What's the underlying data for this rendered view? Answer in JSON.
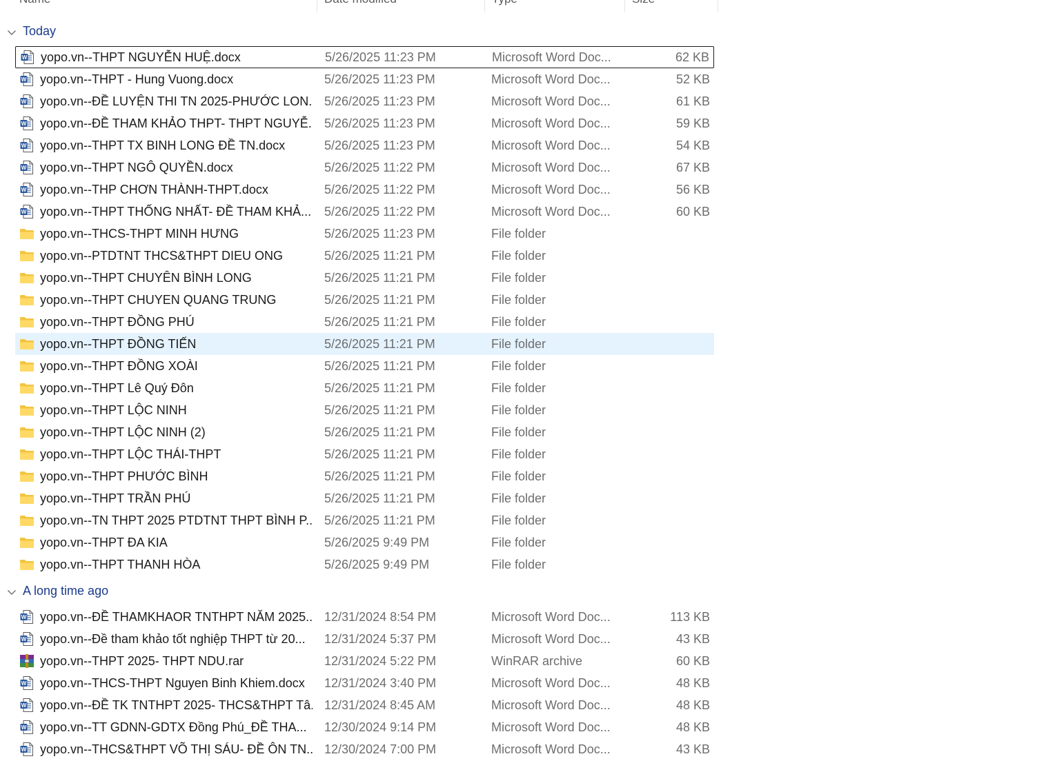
{
  "columns": {
    "name": "Name",
    "date": "Date modified",
    "type": "Type",
    "size": "Size"
  },
  "groups": [
    {
      "label": "Today",
      "rows": [
        {
          "icon": "word-doc-icon",
          "name": "yopo.vn--THPT NGUYỄN HUỆ.docx",
          "date": "5/26/2025 11:23 PM",
          "type": "Microsoft Word Doc...",
          "size": "62 KB"
        },
        {
          "icon": "word-doc-icon",
          "name": "yopo.vn--THPT - Hung Vuong.docx",
          "date": "5/26/2025 11:23 PM",
          "type": "Microsoft Word Doc...",
          "size": "52 KB"
        },
        {
          "icon": "word-doc-icon",
          "name": "yopo.vn--ĐỀ LUYỆN THI TN 2025-PHƯỚC LON...",
          "date": "5/26/2025 11:23 PM",
          "type": "Microsoft Word Doc...",
          "size": "61 KB"
        },
        {
          "icon": "word-doc-icon",
          "name": "yopo.vn--ĐỀ THAM KHẢO THPT- THPT NGUYỄ...",
          "date": "5/26/2025 11:23 PM",
          "type": "Microsoft Word Doc...",
          "size": "59 KB"
        },
        {
          "icon": "word-doc-icon",
          "name": "yopo.vn--THPT TX BINH LONG ĐỀ TN.docx",
          "date": "5/26/2025 11:23 PM",
          "type": "Microsoft Word Doc...",
          "size": "54 KB"
        },
        {
          "icon": "word-doc-icon",
          "name": "yopo.vn--THPT NGÔ QUYỀN.docx",
          "date": "5/26/2025 11:22 PM",
          "type": "Microsoft Word Doc...",
          "size": "67 KB"
        },
        {
          "icon": "word-doc-icon",
          "name": "yopo.vn--THP CHƠN THÀNH-THPT.docx",
          "date": "5/26/2025 11:22 PM",
          "type": "Microsoft Word Doc...",
          "size": "56 KB"
        },
        {
          "icon": "word-doc-icon",
          "name": "yopo.vn--THPT THỐNG NHẤT- ĐỀ THAM KHẢ...",
          "date": "5/26/2025 11:22 PM",
          "type": "Microsoft Word Doc...",
          "size": "60 KB"
        },
        {
          "icon": "folder-icon",
          "name": "yopo.vn--THCS-THPT MINH HƯNG",
          "date": "5/26/2025 11:23 PM",
          "type": "File folder",
          "size": ""
        },
        {
          "icon": "folder-icon",
          "name": "yopo.vn--PTDTNT THCS&THPT DIEU ONG",
          "date": "5/26/2025 11:21 PM",
          "type": "File folder",
          "size": ""
        },
        {
          "icon": "folder-icon",
          "name": "yopo.vn--THPT CHUYÊN BÌNH LONG",
          "date": "5/26/2025 11:21 PM",
          "type": "File folder",
          "size": ""
        },
        {
          "icon": "folder-icon",
          "name": "yopo.vn--THPT CHUYEN QUANG TRUNG",
          "date": "5/26/2025 11:21 PM",
          "type": "File folder",
          "size": ""
        },
        {
          "icon": "folder-icon",
          "name": "yopo.vn--THPT ĐỒNG PHÚ",
          "date": "5/26/2025 11:21 PM",
          "type": "File folder",
          "size": ""
        },
        {
          "icon": "folder-icon",
          "name": "yopo.vn--THPT ĐỒNG TIẾN",
          "date": "5/26/2025 11:21 PM",
          "type": "File folder",
          "size": ""
        },
        {
          "icon": "folder-icon",
          "name": "yopo.vn--THPT ĐỒNG XOÀI",
          "date": "5/26/2025 11:21 PM",
          "type": "File folder",
          "size": ""
        },
        {
          "icon": "folder-icon",
          "name": "yopo.vn--THPT Lê Quý Đôn",
          "date": "5/26/2025 11:21 PM",
          "type": "File folder",
          "size": ""
        },
        {
          "icon": "folder-icon",
          "name": "yopo.vn--THPT LỘC NINH",
          "date": "5/26/2025 11:21 PM",
          "type": "File folder",
          "size": ""
        },
        {
          "icon": "folder-icon",
          "name": "yopo.vn--THPT LỘC NINH (2)",
          "date": "5/26/2025 11:21 PM",
          "type": "File folder",
          "size": ""
        },
        {
          "icon": "folder-icon",
          "name": "yopo.vn--THPT LỘC THÁI-THPT",
          "date": "5/26/2025 11:21 PM",
          "type": "File folder",
          "size": ""
        },
        {
          "icon": "folder-icon",
          "name": "yopo.vn--THPT PHƯỚC BÌNH",
          "date": "5/26/2025 11:21 PM",
          "type": "File folder",
          "size": ""
        },
        {
          "icon": "folder-icon",
          "name": "yopo.vn--THPT TRẦN PHÚ",
          "date": "5/26/2025 11:21 PM",
          "type": "File folder",
          "size": ""
        },
        {
          "icon": "folder-icon",
          "name": "yopo.vn--TN THPT 2025 PTDTNT THPT BÌNH P...",
          "date": "5/26/2025 11:21 PM",
          "type": "File folder",
          "size": ""
        },
        {
          "icon": "folder-icon",
          "name": "yopo.vn--THPT ĐA KIA",
          "date": "5/26/2025 9:49 PM",
          "type": "File folder",
          "size": ""
        },
        {
          "icon": "folder-icon",
          "name": "yopo.vn--THPT THANH HÒA",
          "date": "5/26/2025 9:49 PM",
          "type": "File folder",
          "size": ""
        }
      ]
    },
    {
      "label": "A long time ago",
      "rows": [
        {
          "icon": "word-doc-icon",
          "name": "yopo.vn--ĐỀ THAMKHAOR TNTHPT NĂM 2025...",
          "date": "12/31/2024 8:54 PM",
          "type": "Microsoft Word Doc...",
          "size": "113 KB"
        },
        {
          "icon": "word-doc-icon",
          "name": "yopo.vn--Đề tham khảo tốt nghiệp THPT từ 20...",
          "date": "12/31/2024 5:37 PM",
          "type": "Microsoft Word Doc...",
          "size": "43 KB"
        },
        {
          "icon": "winrar-icon",
          "name": "yopo.vn--THPT 2025- THPT NDU.rar",
          "date": "12/31/2024 5:22 PM",
          "type": "WinRAR archive",
          "size": "60 KB"
        },
        {
          "icon": "word-doc-icon",
          "name": "yopo.vn--THCS-THPT Nguyen Binh Khiem.docx",
          "date": "12/31/2024 3:40 PM",
          "type": "Microsoft Word Doc...",
          "size": "48 KB"
        },
        {
          "icon": "word-doc-icon",
          "name": "yopo.vn--ĐỀ TK TNTHPT 2025- THCS&THPT Tâ...",
          "date": "12/31/2024 8:45 AM",
          "type": "Microsoft Word Doc...",
          "size": "48 KB"
        },
        {
          "icon": "word-doc-icon",
          "name": "yopo.vn--TT GDNN-GDTX Đồng Phú_ĐỀ THA...",
          "date": "12/30/2024 9:14 PM",
          "type": "Microsoft Word Doc...",
          "size": "48 KB"
        },
        {
          "icon": "word-doc-icon",
          "name": "yopo.vn--THCS&THPT VÕ THỊ SÁU- ĐỀ ÔN TN...",
          "date": "12/30/2024 7:00 PM",
          "type": "Microsoft Word Doc...",
          "size": "43 KB"
        }
      ]
    }
  ]
}
